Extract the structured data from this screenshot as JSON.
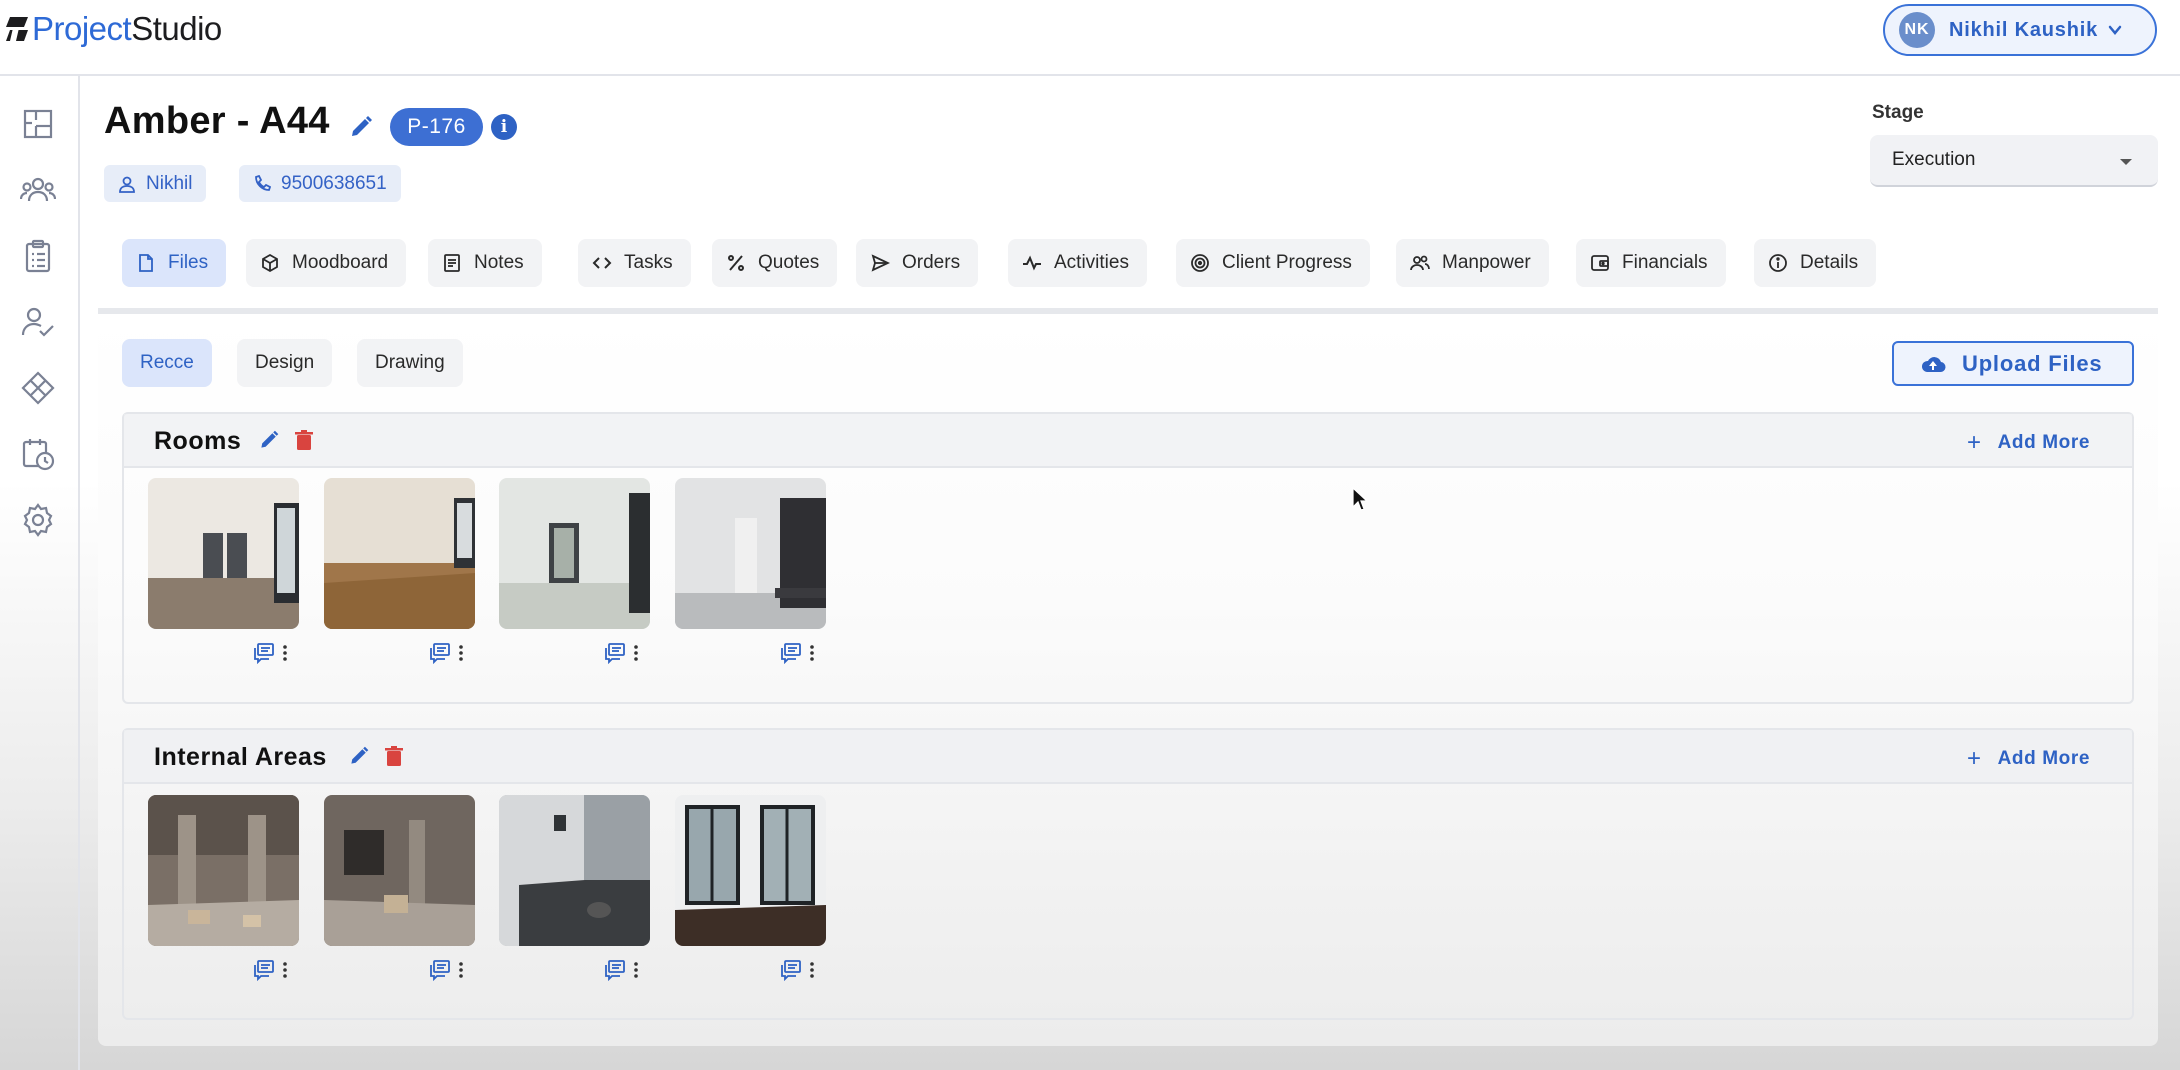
{
  "app": {
    "logo_part1": "Project",
    "logo_part2": "Studio"
  },
  "user": {
    "initials": "NK",
    "name": "Nikhil Kaushik"
  },
  "project": {
    "title": "Amber - A44",
    "id_badge": "P-176",
    "contact_name": "Nikhil",
    "phone": "9500638651"
  },
  "stage": {
    "label": "Stage",
    "value": "Execution"
  },
  "tabs": [
    {
      "label": "Files",
      "icon": "file-icon",
      "active": true
    },
    {
      "label": "Moodboard",
      "icon": "cube-icon"
    },
    {
      "label": "Notes",
      "icon": "notes-icon"
    },
    {
      "label": "Tasks",
      "icon": "code-icon"
    },
    {
      "label": "Quotes",
      "icon": "percent-icon"
    },
    {
      "label": "Orders",
      "icon": "send-icon"
    },
    {
      "label": "Activities",
      "icon": "pulse-icon"
    },
    {
      "label": "Client Progress",
      "icon": "progress-icon"
    },
    {
      "label": "Manpower",
      "icon": "people-icon"
    },
    {
      "label": "Financials",
      "icon": "wallet-icon"
    },
    {
      "label": "Details",
      "icon": "info-icon"
    }
  ],
  "subtabs": [
    {
      "label": "Recce",
      "active": true
    },
    {
      "label": "Design"
    },
    {
      "label": "Drawing"
    }
  ],
  "upload_label": "Upload Files",
  "sections": [
    {
      "title": "Rooms",
      "add_label": "Add More",
      "photo_count": 4
    },
    {
      "title": "Internal Areas",
      "add_label": "Add More",
      "photo_count": 4
    }
  ],
  "sidebar_icons": [
    "floorplan-icon",
    "team-icon",
    "clipboard-icon",
    "user-check-icon",
    "diamond-grid-icon",
    "calendar-clock-icon",
    "settings-icon"
  ],
  "colors": {
    "accent": "#2e62c4",
    "badge": "#3d6fd3",
    "active_tab_bg": "#dbe5fb",
    "delete": "#d9443f"
  }
}
